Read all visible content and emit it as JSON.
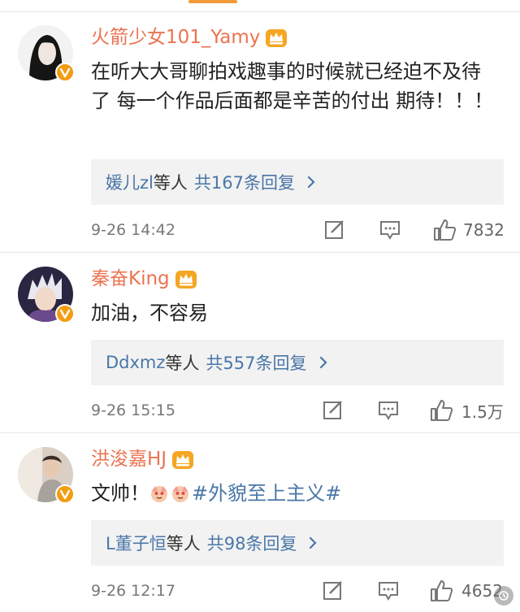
{
  "colors": {
    "username": "#eb7350",
    "link": "#4a76a8",
    "vip_badge": "#f39c12",
    "tab_indicator": "#f29a38"
  },
  "comments": [
    {
      "username": "火箭少女101_Yamy",
      "content": "在听大大哥聊拍戏趣事的时候就已经迫不及待了 每一个作品后面都是辛苦的付出 期待！！！",
      "replies": {
        "who": "媛儿zl",
        "deng": "等人",
        "count": "共167条回复"
      },
      "time": "9-26 14:42",
      "likes": "7832",
      "icons": [
        "edit-icon",
        "comment-icon",
        "like-icon"
      ]
    },
    {
      "username": "秦奋King",
      "content": "加油，不容易",
      "replies": {
        "who": "Ddxmz",
        "deng": "等人",
        "count": "共557条回复"
      },
      "time": "9-26 15:15",
      "likes": "1.5万",
      "icons": [
        "edit-icon",
        "comment-icon",
        "like-icon"
      ]
    },
    {
      "username": "洪浚嘉HJ",
      "content_prefix": "文帅！",
      "hashtag": "#外貌至上主义#",
      "replies": {
        "who": "L董子恒",
        "deng": "等人",
        "count": "共98条回复"
      },
      "time": "9-26 12:17",
      "likes": "4652",
      "icons": [
        "edit-icon",
        "comment-icon",
        "like-icon"
      ]
    }
  ]
}
